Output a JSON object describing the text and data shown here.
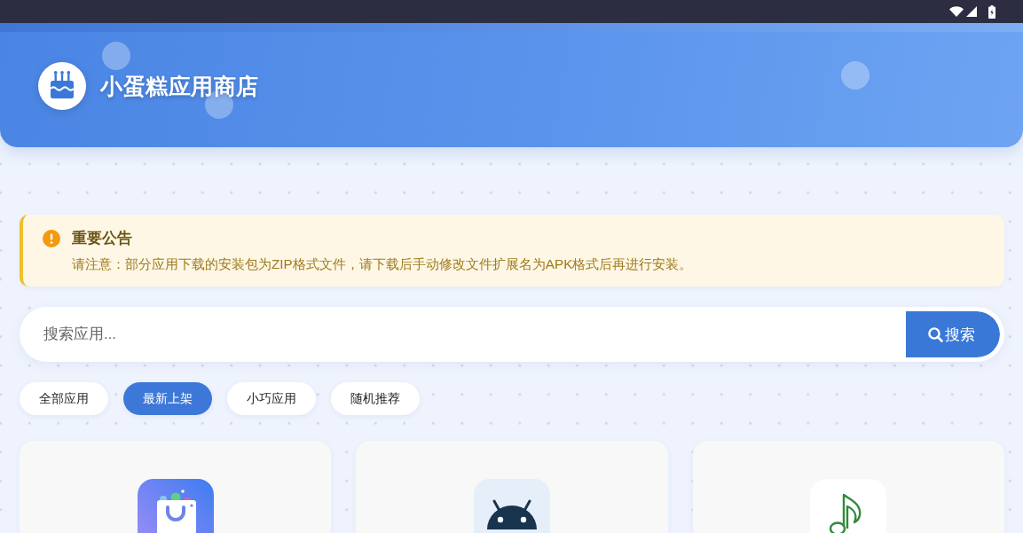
{
  "header": {
    "title": "小蛋糕应用商店"
  },
  "notice": {
    "title": "重要公告",
    "text": "请注意：部分应用下载的安装包为ZIP格式文件，请下载后手动修改文件扩展名为APK格式后再进行安装。"
  },
  "search": {
    "placeholder": "搜索应用...",
    "button": "搜索"
  },
  "filters": [
    {
      "label": "全部应用",
      "selected": false
    },
    {
      "label": "最新上架",
      "selected": true
    },
    {
      "label": "小巧应用",
      "selected": false
    },
    {
      "label": "随机推荐",
      "selected": false
    }
  ],
  "apps": [
    {
      "kind": "bag"
    },
    {
      "kind": "robot"
    },
    {
      "kind": "note"
    }
  ]
}
